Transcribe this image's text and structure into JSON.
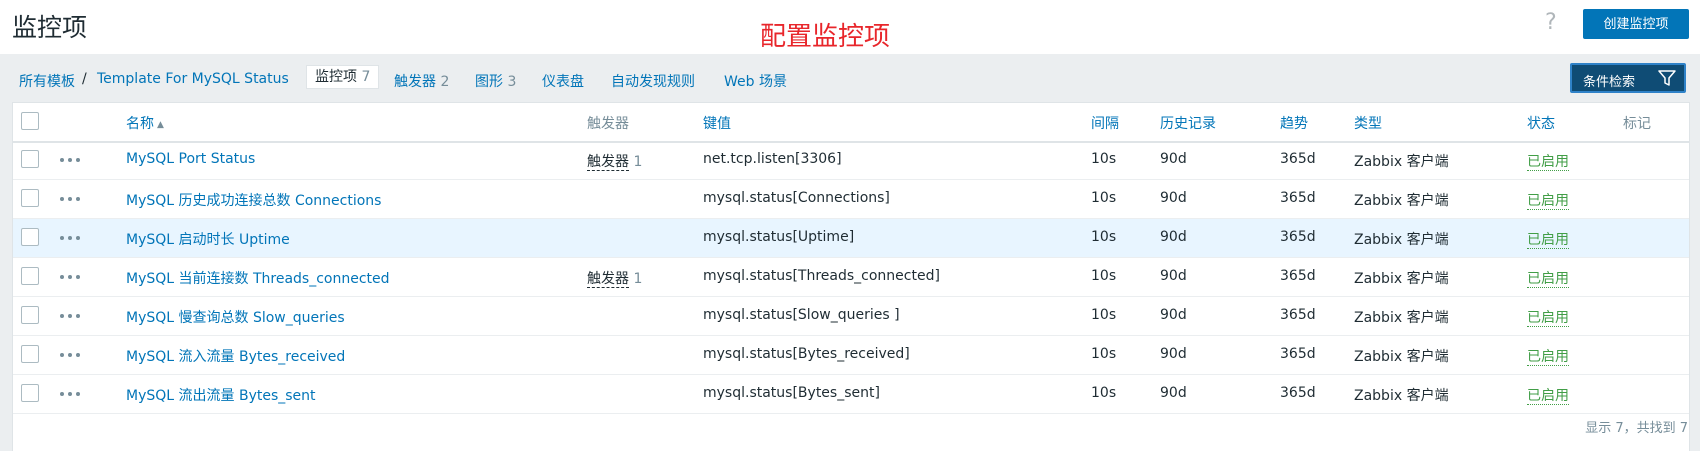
{
  "header": {
    "title": "监控项",
    "annotation": "配置监控项",
    "help_icon": "?",
    "create_button": "创建监控项"
  },
  "nav": {
    "all_templates": "所有模板",
    "separator": "/",
    "template": "Template For MySQL Status",
    "items_label": "监控项",
    "items_count": "7",
    "triggers_label": "触发器",
    "triggers_count": "2",
    "graphs_label": "图形",
    "graphs_count": "3",
    "dashboards": "仪表盘",
    "discovery": "自动发现规则",
    "web": "Web 场景",
    "filter_button": "条件检索"
  },
  "table": {
    "columns": {
      "name": "名称",
      "triggers": "触发器",
      "key": "键值",
      "interval": "间隔",
      "history": "历史记录",
      "trends": "趋势",
      "type": "类型",
      "status": "状态",
      "tags": "标记"
    },
    "rows": [
      {
        "name": "MySQL Port Status",
        "trigger_label": "触发器",
        "trigger_count": "1",
        "key": "net.tcp.listen[3306]",
        "interval": "10s",
        "history": "90d",
        "trends": "365d",
        "type": "Zabbix 客户端",
        "status": "已启用"
      },
      {
        "name": "MySQL 历史成功连接总数  Connections",
        "trigger_label": "",
        "trigger_count": "",
        "key": "mysql.status[Connections]",
        "interval": "10s",
        "history": "90d",
        "trends": "365d",
        "type": "Zabbix 客户端",
        "status": "已启用"
      },
      {
        "name": "MySQL 启动时长  Uptime",
        "trigger_label": "",
        "trigger_count": "",
        "key": "mysql.status[Uptime]",
        "interval": "10s",
        "history": "90d",
        "trends": "365d",
        "type": "Zabbix 客户端",
        "status": "已启用"
      },
      {
        "name": "MySQL 当前连接数  Threads_connected",
        "trigger_label": "触发器",
        "trigger_count": "1",
        "key": "mysql.status[Threads_connected]",
        "interval": "10s",
        "history": "90d",
        "trends": "365d",
        "type": "Zabbix 客户端",
        "status": "已启用"
      },
      {
        "name": "MySQL 慢查询总数 Slow_queries",
        "trigger_label": "",
        "trigger_count": "",
        "key": "mysql.status[Slow_queries ]",
        "interval": "10s",
        "history": "90d",
        "trends": "365d",
        "type": "Zabbix 客户端",
        "status": "已启用"
      },
      {
        "name": "MySQL 流入流量  Bytes_received",
        "trigger_label": "",
        "trigger_count": "",
        "key": "mysql.status[Bytes_received]",
        "interval": "10s",
        "history": "90d",
        "trends": "365d",
        "type": "Zabbix 客户端",
        "status": "已启用"
      },
      {
        "name": "MySQL 流出流量  Bytes_sent",
        "trigger_label": "",
        "trigger_count": "",
        "key": "mysql.status[Bytes_sent]",
        "interval": "10s",
        "history": "90d",
        "trends": "365d",
        "type": "Zabbix 客户端",
        "status": "已启用"
      }
    ],
    "footer": "显示 7，共找到 7"
  },
  "colors": {
    "link": "#0275b8",
    "status_enabled": "#429e47",
    "annotation": "#e8262b",
    "highlight_row": "#e8f5ff"
  }
}
